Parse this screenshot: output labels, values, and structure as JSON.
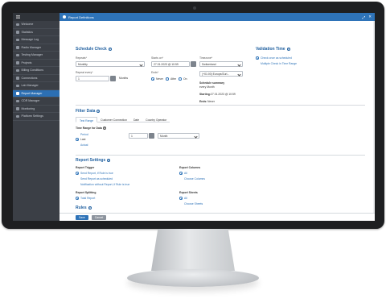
{
  "dialog": {
    "title": "Report Definitions",
    "expand_icon": "expand-icon",
    "close_icon": "close-icon"
  },
  "sidebar": {
    "menu_icon": "hamburger-icon",
    "items": [
      {
        "label": "Welcome"
      },
      {
        "label": "Statistics"
      },
      {
        "label": "Message Log"
      },
      {
        "label": "Radio Manager"
      },
      {
        "label": "Testing Manager"
      },
      {
        "label": "Projects"
      },
      {
        "label": "Billing Conditions"
      },
      {
        "label": "Connections"
      },
      {
        "label": "Lab Manager"
      },
      {
        "label": "Report Manager",
        "active": true
      },
      {
        "label": "CDR Manager"
      },
      {
        "label": "Monitoring"
      },
      {
        "label": "Platform Settings"
      }
    ]
  },
  "schedule": {
    "title": "Schedule Check",
    "repeats_label": "Repeats*",
    "repeats_value": "Monthly",
    "starts_label": "Starts on*",
    "starts_value": "27.01.2023 @ 10:59",
    "timezone_label": "Timezone*",
    "timezone_value": "Switzerland",
    "timezone_select": "(+01:00) Europe/Zuri...",
    "repeat_every_label": "Repeat every*",
    "repeat_every_value": "1",
    "repeat_every_unit": "Months",
    "ends_label": "Ends*",
    "ends_options": [
      "Never",
      "After",
      "On"
    ],
    "summary_label": "Schedule summary",
    "summary_value": "every Month",
    "starting_label": "Starting:",
    "starting_value": "27.01.2023 @ 10:59",
    "ends_summary_label": "Ends:",
    "ends_summary_value": "Never"
  },
  "validation": {
    "title": "Validation Time",
    "option1": "Check once as scheduled",
    "option2": "Multiple Check in Time Range"
  },
  "filter": {
    "title": "Filter Data",
    "tabs": [
      "Test Range",
      "Customer Connection",
      "Date",
      "Country Operator"
    ],
    "time_range_label": "Time Range for Data",
    "options": [
      "Period",
      "Last",
      "Actual"
    ],
    "period_value": "1",
    "period_unit": "Month"
  },
  "report_settings": {
    "title": "Report Settings",
    "trigger_label": "Report Trigger",
    "trigger_options": [
      "Send Report, if Rule is true",
      "Send Report as scheduled",
      "Notification without Report, if Rule is true"
    ],
    "splitting_label": "Report Splitting",
    "splitting_option": "Total Report",
    "columns_label": "Export Columns",
    "columns_options": [
      "All",
      "Choose Columns"
    ],
    "sheets_label": "Export Sheets",
    "sheets_options": [
      "All",
      "Choose Sheets"
    ]
  },
  "rules": {
    "title": "Rules"
  },
  "footer": {
    "save_label": "Save",
    "cancel_label": "Cancel"
  },
  "colors": {
    "accent": "#2e73b8",
    "sidebar": "#3b3f46",
    "bezel": "#1e1f21"
  }
}
